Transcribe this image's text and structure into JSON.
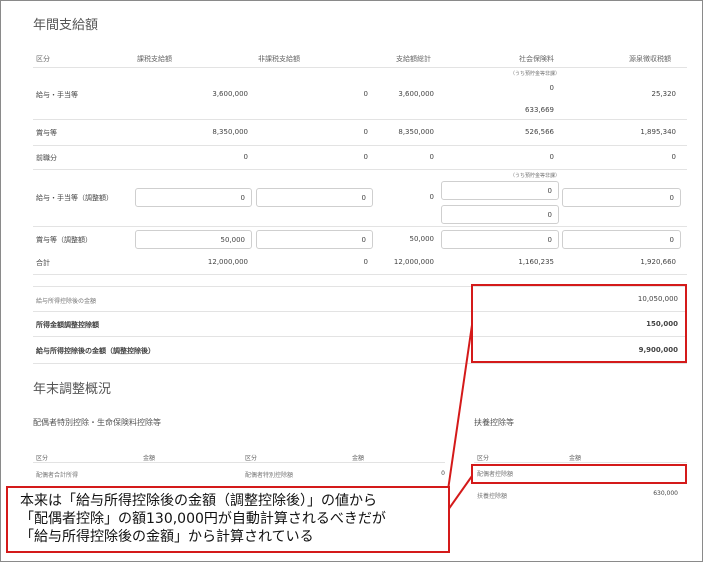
{
  "annual": {
    "title": "年間支給額",
    "headers": [
      "区分",
      "課税支給額",
      "非課税支給額",
      "支給額総計",
      "社会保険料",
      "源泉徴収税額"
    ],
    "sub_note": "（うち預貯金等非課）",
    "rows": [
      {
        "label": "給与・手当等",
        "taxable": "3,600,000",
        "nontax": "0",
        "total": "3,600,000",
        "ins_sub": "0",
        "ins": "633,669",
        "wh": "25,320"
      },
      {
        "label": "賞与等",
        "taxable": "8,350,000",
        "nontax": "0",
        "total": "8,350,000",
        "ins": "526,566",
        "wh": "1,895,340"
      },
      {
        "label": "前職分",
        "taxable": "0",
        "nontax": "0",
        "total": "0",
        "ins": "0",
        "wh": "0"
      },
      {
        "label": "給与・手当等（調整額）",
        "taxable": "0",
        "nontax": "0",
        "total": "0",
        "ins_sub": "0",
        "ins": "0",
        "wh": "0"
      },
      {
        "label": "賞与等（調整額）",
        "taxable": "50,000",
        "nontax": "0",
        "total": "50,000",
        "ins": "0",
        "wh": "0"
      },
      {
        "label": "合計",
        "taxable": "12,000,000",
        "nontax": "0",
        "total": "12,000,000",
        "ins": "1,160,235",
        "wh": "1,920,660"
      }
    ],
    "summary": [
      {
        "label": "給与所得控除後の金額",
        "value": "10,050,000"
      },
      {
        "label": "所得金額調整控除額",
        "value": "150,000"
      },
      {
        "label": "給与所得控除後の金額（調整控除後）",
        "value": "9,900,000"
      }
    ]
  },
  "yearend": {
    "title": "年末調整概況",
    "left_title": "配偶者特別控除・生命保険料控除等",
    "right_title": "扶養控除等",
    "left_headers": [
      "区分",
      "金額",
      "区分",
      "金額"
    ],
    "right_headers": [
      "区分",
      "金額"
    ],
    "left_row": {
      "a": "配偶者合計所得",
      "b": "配偶者特別控除額",
      "b_val": "0"
    },
    "right_rows": [
      {
        "label": "配偶者控除額",
        "value": ""
      },
      {
        "label": "扶養控除額",
        "value": "630,000"
      }
    ]
  },
  "callout": {
    "lines": [
      "本来は「給与所得控除後の金額（調整控除後）」の値から",
      "「配偶者控除」の額130,000円が自動計算されるべきだが",
      "「給与所得控除後の金額」から計算されている"
    ]
  },
  "colors": {
    "accent": "#d41a1a"
  }
}
